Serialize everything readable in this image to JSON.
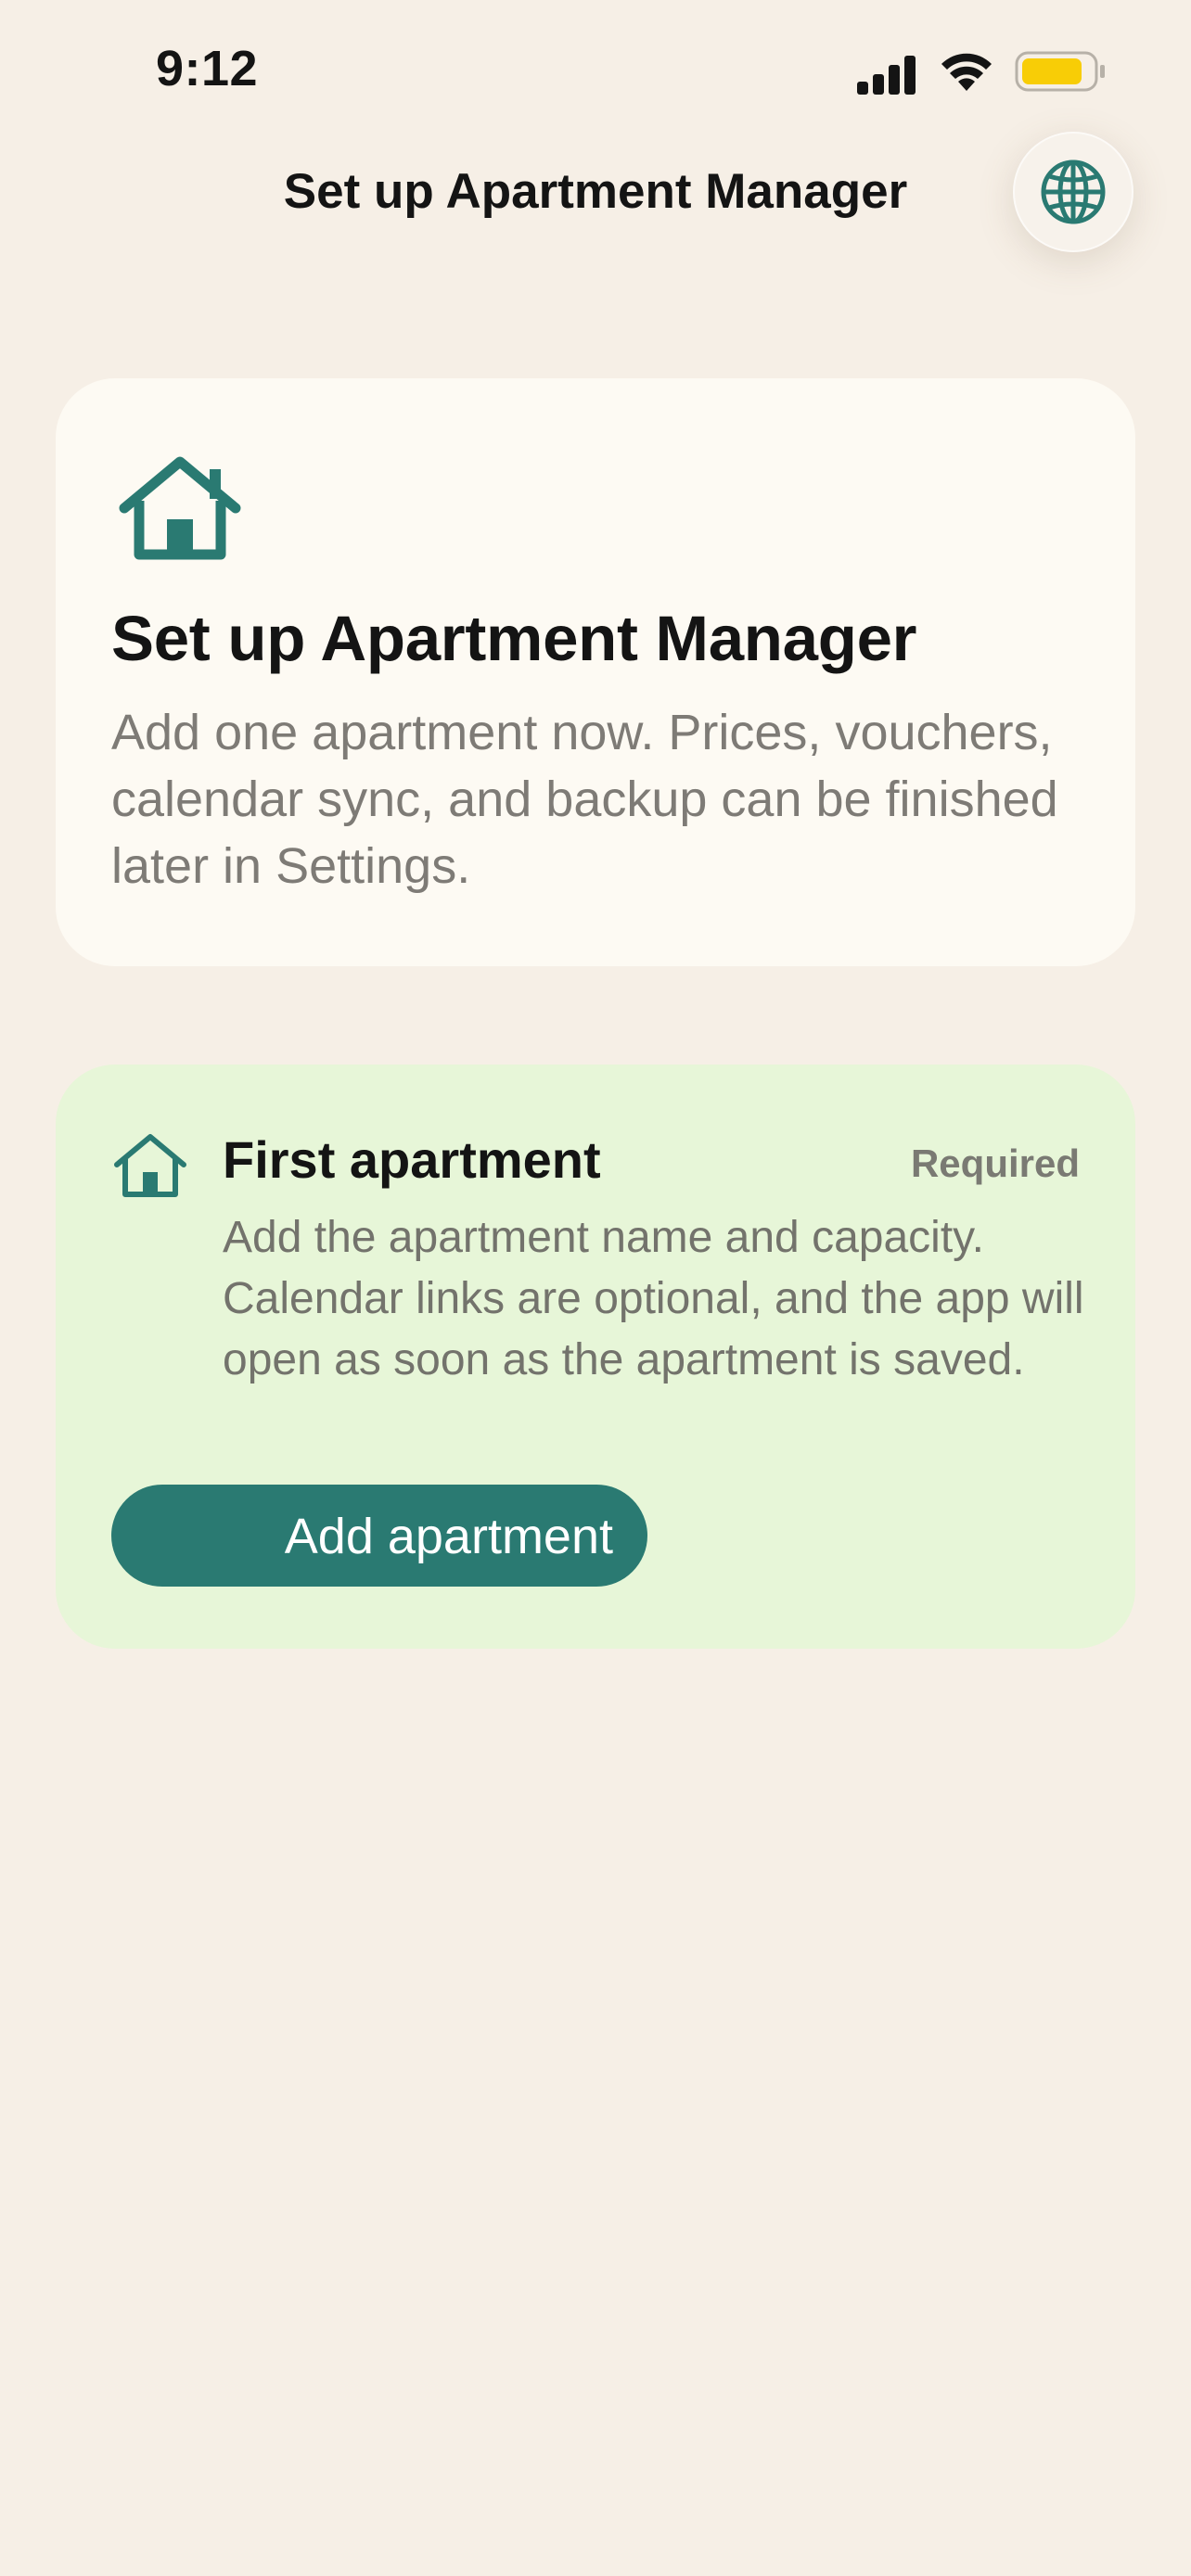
{
  "status_bar": {
    "time": "9:12",
    "icons": [
      "cellular-signal-icon",
      "wifi-icon",
      "battery-icon"
    ],
    "battery_color": "#F8CD06"
  },
  "nav": {
    "title": "Set up Apartment Manager",
    "language_button_icon": "globe-icon"
  },
  "hero": {
    "icon": "house-icon",
    "title": "Set up Apartment Manager",
    "description": "Add one apartment now. Prices, vouchers, calendar sync, and backup can be finished later in Settings."
  },
  "step": {
    "icon": "house-icon",
    "title": "First apartment",
    "badge": "Required",
    "description": "Add the apartment name and capacity. Calendar links are optional, and the app will open as soon as the apartment is saved.",
    "button_label": "Add apartment"
  },
  "colors": {
    "accent": "#2A7A72",
    "background": "#F6EFE6",
    "hero_card": "#FDFAF3",
    "step_card": "#E7F6D8"
  }
}
